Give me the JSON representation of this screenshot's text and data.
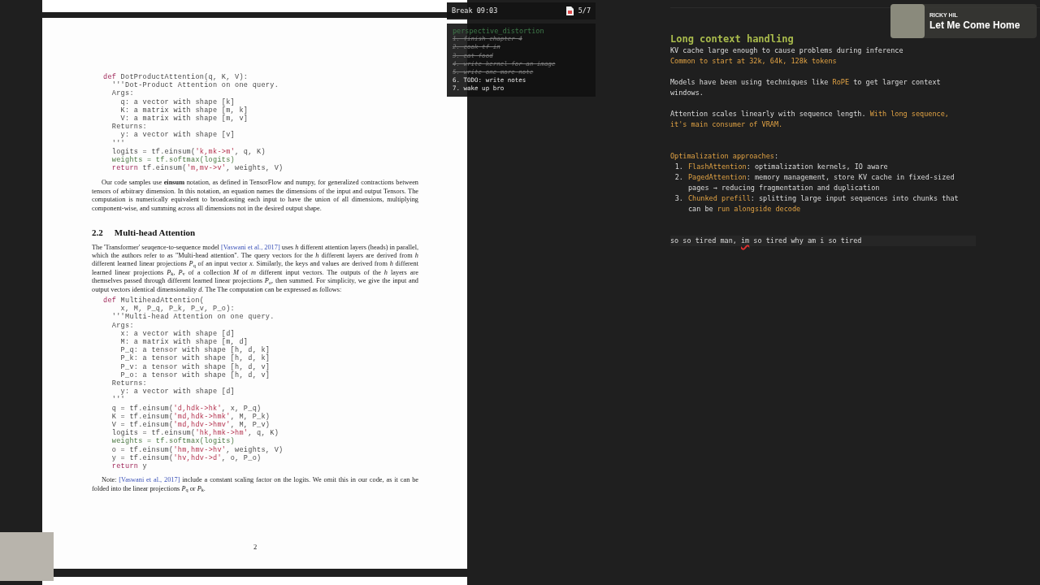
{
  "document": {
    "code_1": [
      [
        {
          "text": "def",
          "kind": "kw"
        },
        {
          "text": " DotProductAttention(q, K, V):",
          "kind": "plain"
        }
      ],
      [
        {
          "text": "  '''Dot-Product Attention on one query.",
          "kind": "plain"
        }
      ],
      [
        {
          "text": "  Args:",
          "kind": "plain"
        }
      ],
      [
        {
          "text": "    q: a vector with shape [k]",
          "kind": "plain"
        }
      ],
      [
        {
          "text": "    K: a matrix with shape [m, k]",
          "kind": "plain"
        }
      ],
      [
        {
          "text": "    V: a matrix with shape [m, v]",
          "kind": "plain"
        }
      ],
      [
        {
          "text": "  Returns:",
          "kind": "plain"
        }
      ],
      [
        {
          "text": "    y: a vector with shape [v]",
          "kind": "plain"
        }
      ],
      [
        {
          "text": "  '''",
          "kind": "plain"
        }
      ],
      [
        {
          "text": "  logits = tf.einsum(",
          "kind": "plain"
        },
        {
          "text": "'k,mk->m'",
          "kind": "str"
        },
        {
          "text": ", q, K)",
          "kind": "plain"
        }
      ],
      [
        {
          "text": "  weights = tf.softmax(logits)",
          "kind": "green"
        }
      ],
      [
        {
          "text": "  return",
          "kind": "kw"
        },
        {
          "text": " tf.einsum(",
          "kind": "plain"
        },
        {
          "text": "'m,mv->v'",
          "kind": "str"
        },
        {
          "text": ", weights, V)",
          "kind": "plain"
        }
      ]
    ],
    "paragraph_1": [
      {
        "kind": "text",
        "text": "Our code samples use **einsum** notation, as defined in TensorFlow and numpy, for generalized contractions between tensors of arbitrary dimension. In this notation, an equation names the dimensions of the input and output Tensors. The computation is numerically equivalent to broadcasting each input to have the union of all dimensions, multiplying component-wise, and summing across all dimensions not in the desired output shape."
      }
    ],
    "section_number": "2.2",
    "section_title": "Multi-head Attention",
    "paragraph_2": [
      {
        "kind": "text",
        "text": "The 'Transformer' seuqence-to-sequence model "
      },
      {
        "kind": "link",
        "text": "[Vaswani et al., 2017]"
      },
      {
        "kind": "text",
        "text": " uses *h* different attention layers (heads) in parallel, which the authors refer to as \"Multi-head attention\". The query vectors for the *h* different layers are derived from *h* different learned linear projections *P*$_{q}$ of an input vector *x*. Similarly, the keys and values are derived from *h* different learned linear projections *P*$_{k}$, *P*$_{v}$ of a collection *M* of *m* different input vectors. The outputs of the *h* layers are themselves passed through different learned linear projections *P*$_{o}$, then summed. For simplicity, we give the input and output vectors identical dimensionality *d*. The The computation can be expressed as follows:"
      }
    ],
    "code_2": [
      [
        {
          "text": "def",
          "kind": "kw"
        },
        {
          "text": " MultiheadAttention(",
          "kind": "plain"
        }
      ],
      [
        {
          "text": "    x, M, P_q, P_k, P_v, P_o):",
          "kind": "plain"
        }
      ],
      [
        {
          "text": "  '''Multi-head Attention on one query.",
          "kind": "plain"
        }
      ],
      [
        {
          "text": "  Args:",
          "kind": "plain"
        }
      ],
      [
        {
          "text": "    x: a vector with shape [d]",
          "kind": "plain"
        }
      ],
      [
        {
          "text": "    M: a matrix with shape [m, d]",
          "kind": "plain"
        }
      ],
      [
        {
          "text": "    P_q: a tensor with shape [h, d, k]",
          "kind": "plain"
        }
      ],
      [
        {
          "text": "    P_k: a tensor with shape [h, d, k]",
          "kind": "plain"
        }
      ],
      [
        {
          "text": "    P_v: a tensor with shape [h, d, v]",
          "kind": "plain"
        }
      ],
      [
        {
          "text": "    P_o: a tensor with shape [h, d, v]",
          "kind": "plain"
        }
      ],
      [
        {
          "text": "  Returns:",
          "kind": "plain"
        }
      ],
      [
        {
          "text": "    y: a vector with shape [d]",
          "kind": "plain"
        }
      ],
      [
        {
          "text": "  '''",
          "kind": "plain"
        }
      ],
      [
        {
          "text": "  q = tf.einsum(",
          "kind": "plain"
        },
        {
          "text": "'d,hdk->hk'",
          "kind": "str"
        },
        {
          "text": ", x, P_q)",
          "kind": "plain"
        }
      ],
      [
        {
          "text": "  K = tf.einsum(",
          "kind": "plain"
        },
        {
          "text": "'md,hdk->hmk'",
          "kind": "str"
        },
        {
          "text": ", M, P_k)",
          "kind": "plain"
        }
      ],
      [
        {
          "text": "  V = tf.einsum(",
          "kind": "plain"
        },
        {
          "text": "'md,hdv->hmv'",
          "kind": "str"
        },
        {
          "text": ", M, P_v)",
          "kind": "plain"
        }
      ],
      [
        {
          "text": "  logits = tf.einsum(",
          "kind": "plain"
        },
        {
          "text": "'hk,hmk->hm'",
          "kind": "str"
        },
        {
          "text": ", q, K)",
          "kind": "plain"
        }
      ],
      [
        {
          "text": "  weights = tf.softmax(logits)",
          "kind": "green"
        }
      ],
      [
        {
          "text": "  o = tf.einsum(",
          "kind": "plain"
        },
        {
          "text": "'hm,hmv->hv'",
          "kind": "str"
        },
        {
          "text": ", weights, V)",
          "kind": "plain"
        }
      ],
      [
        {
          "text": "  y = tf.einsum(",
          "kind": "plain"
        },
        {
          "text": "'hv,hdv->d'",
          "kind": "str"
        },
        {
          "text": ", o, P_o)",
          "kind": "plain"
        }
      ],
      [
        {
          "text": "  return",
          "kind": "kw"
        },
        {
          "text": " y",
          "kind": "plain"
        }
      ]
    ],
    "note": [
      {
        "kind": "text",
        "text": "Note: "
      },
      {
        "kind": "link",
        "text": "[Vaswani et al., 2017]"
      },
      {
        "kind": "text",
        "text": " include a constant scaling factor on the logits. We omit this in our code, as it can be folded into the linear projections *P*$_{q}$ or *P*$_{k}$."
      }
    ],
    "page_number": "2"
  },
  "timer": {
    "label": "Break 09:03",
    "count": "5/7"
  },
  "todo": {
    "title": "perspective_distortion",
    "items": [
      {
        "text": "1. finish chapter 4",
        "done": true
      },
      {
        "text": "2. cook tf in",
        "done": true
      },
      {
        "text": "3. eat food",
        "done": true
      },
      {
        "text": "4. write kernel for an image",
        "done": true
      },
      {
        "text": "5. write one more note",
        "done": true
      },
      {
        "text": "6. TODO: write notes",
        "done": false
      },
      {
        "text": "7. wake up bro",
        "done": false
      }
    ]
  },
  "now_playing": {
    "artist": "RICKY HIL",
    "title": "Let Me Come Home"
  },
  "notes": {
    "sections": [
      {
        "kind": "text",
        "blocks": [
          {
            "kind": "heading",
            "text": "Long context handling"
          },
          {
            "kind": "para",
            "segs": [
              {
                "text": "KV cache large enough to cause problems during inference",
                "accent": false
              }
            ]
          },
          {
            "kind": "para",
            "segs": [
              {
                "text": "Common to start at 32k, 64k, 128k tokens",
                "accent": true
              }
            ]
          }
        ]
      },
      {
        "kind": "text",
        "blocks": [
          {
            "kind": "para",
            "segs": [
              {
                "text": "Models have been using techniques like ",
                "accent": false
              },
              {
                "text": "RoPE",
                "accent": true
              },
              {
                "text": " to get larger context windows.",
                "accent": false
              }
            ]
          }
        ]
      },
      {
        "kind": "text",
        "blocks": [
          {
            "kind": "para",
            "segs": [
              {
                "text": "Attention scales linearly with sequence length. ",
                "accent": false
              },
              {
                "text": "With long sequence, it's main consumer of VRAM.",
                "accent": true
              }
            ]
          }
        ]
      },
      {
        "kind": "list",
        "blocks": [
          {
            "kind": "para",
            "segs": [
              {
                "text": "Optimalization approaches",
                "accent": true
              },
              {
                "text": ":",
                "accent": false
              }
            ]
          },
          {
            "kind": "item",
            "number": "1.",
            "segs": [
              {
                "text": "FlashAttention",
                "accent": true
              },
              {
                "text": ": optimalization kernels, IO aware",
                "accent": false
              }
            ]
          },
          {
            "kind": "item",
            "number": "2.",
            "segs": [
              {
                "text": "PagedAttention",
                "accent": true
              },
              {
                "text": ": memory management, store KV cache in fixed-sized pages → reducing fragmentation and duplication",
                "accent": false
              }
            ]
          },
          {
            "kind": "item",
            "number": "3.",
            "segs": [
              {
                "text": "Chunked prefill",
                "accent": true
              },
              {
                "text": ": splitting large input sequences into chunks that can be ",
                "accent": false
              },
              {
                "text": "run alongside decode",
                "accent": true
              }
            ]
          }
        ]
      },
      {
        "kind": "current",
        "blocks": [
          {
            "kind": "para",
            "segs": [
              {
                "text": "so so tired man, ",
                "misspelled": false
              },
              {
                "text": "im",
                "misspelled": true
              },
              {
                "text": " so tired why am i so tired",
                "misspelled": false
              }
            ]
          }
        ]
      }
    ]
  }
}
